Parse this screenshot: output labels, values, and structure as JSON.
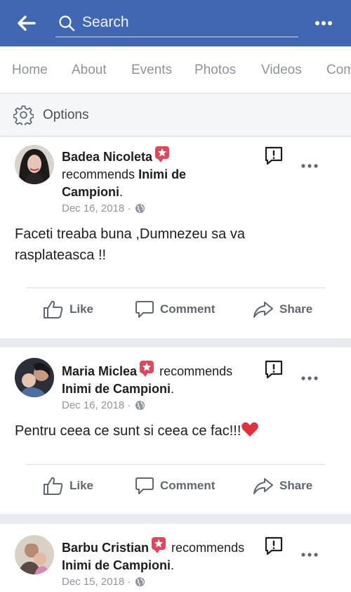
{
  "header": {
    "search_placeholder": "Search",
    "back_icon": "arrow-left-icon",
    "more_icon": "ellipsis-icon",
    "background_color": "#4267b2"
  },
  "tabs": [
    "Home",
    "About",
    "Events",
    "Photos",
    "Videos",
    "Com"
  ],
  "options": {
    "label": "Options",
    "icon": "gear-icon"
  },
  "posts": [
    {
      "author": "Badea Nicoleta",
      "verb": "recommends",
      "page": "Inimi de Campioni",
      "date": "Dec 16, 2018",
      "separator": "·",
      "text_line1": "Faceti treaba buna ,Dumnezeu sa va",
      "text_line2": "rasplateasca !!",
      "actions": {
        "like": "Like",
        "comment": "Comment",
        "share": "Share"
      }
    },
    {
      "author": "Maria Miclea",
      "verb": "recommends",
      "page": "Inimi de Campioni",
      "date": "Dec 16, 2018",
      "separator": "·",
      "text_line1": "Pentru ceea ce sunt si ceea ce fac!!!",
      "actions": {
        "like": "Like",
        "comment": "Comment",
        "share": "Share"
      }
    },
    {
      "author": "Barbu Cristian",
      "verb": "recommends",
      "page": "Inimi de Campioni",
      "date": "Dec 15, 2018",
      "separator": "·"
    }
  ],
  "colors": {
    "brand_blue": "#4267b2",
    "badge_red": "#e0475c",
    "muted_text": "#90949c",
    "action_text": "#606770"
  }
}
